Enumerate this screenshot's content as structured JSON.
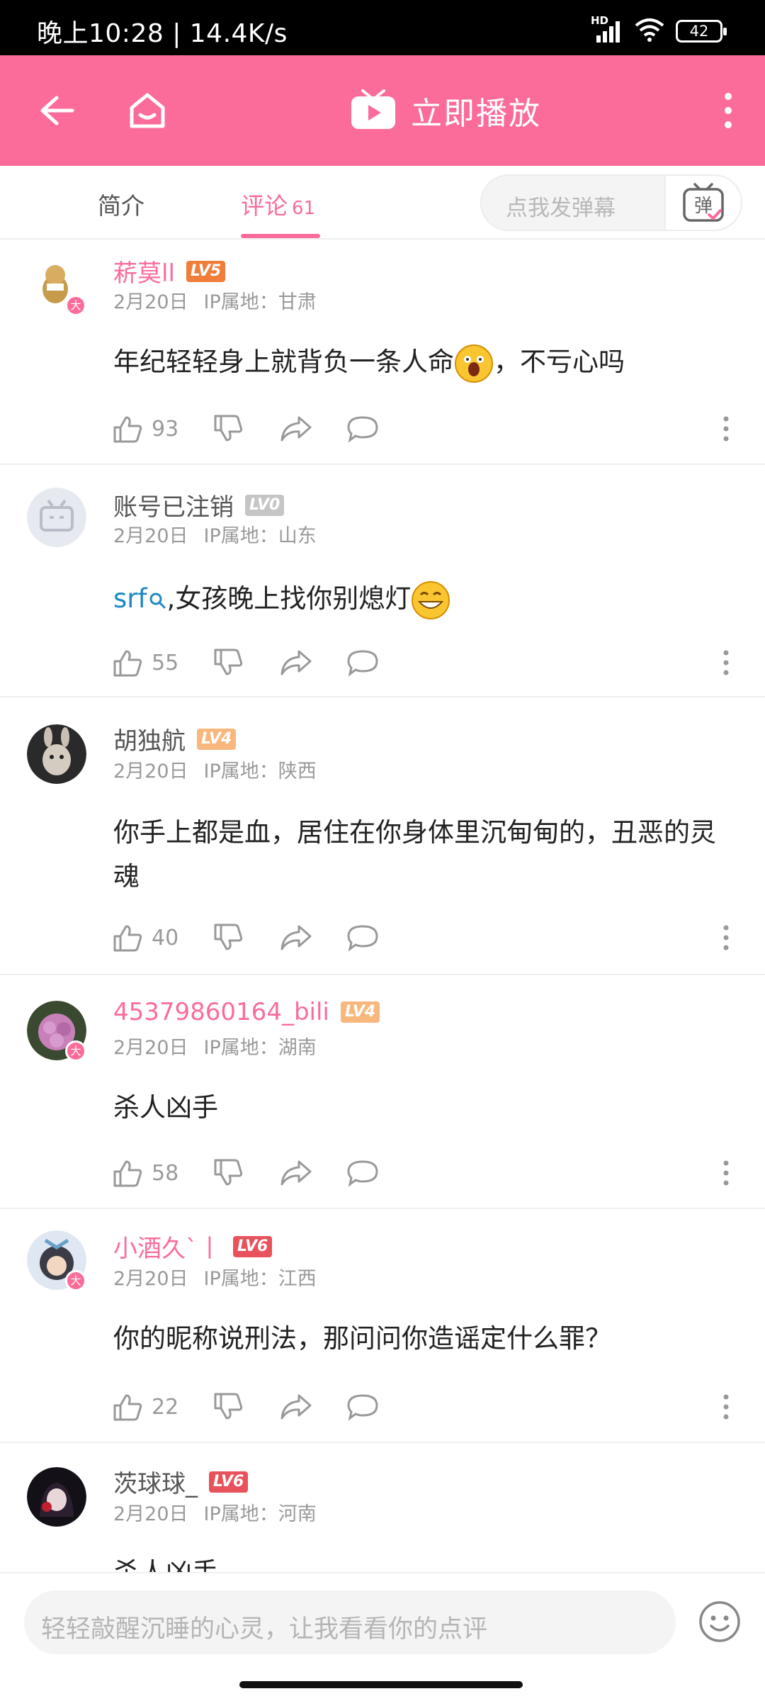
{
  "status_bar": {
    "time": "晚上10:28 | 14.4K/s",
    "hd": "HD",
    "battery": "42"
  },
  "header": {
    "play_label": "立即播放"
  },
  "tabs": [
    {
      "label": "简介"
    },
    {
      "label": "评论",
      "count": "61"
    }
  ],
  "danmaku": {
    "placeholder": "点我发弹幕",
    "button": "弹"
  },
  "comments": [
    {
      "user": "菥莫ll",
      "level": "LV5",
      "date": "2月20日",
      "ip": "IP属地：甘肃",
      "text": "年纪轻轻身上就背负一条人命",
      "text_after": "，不亏心吗",
      "likes": "93"
    },
    {
      "user": "账号已注销",
      "level": "LV0",
      "date": "2月20日",
      "ip": "IP属地：山东",
      "link": "srf",
      "text": ",女孩晚上找你别熄灯",
      "likes": "55"
    },
    {
      "user": "胡独航",
      "level": "LV4",
      "date": "2月20日",
      "ip": "IP属地：陕西",
      "text": "你手上都是血，居住在你身体里沉甸甸的，丑恶的灵魂",
      "likes": "40"
    },
    {
      "user": "45379860164_bili",
      "level": "LV4",
      "date": "2月20日",
      "ip": "IP属地：湖南",
      "text": "杀人凶手",
      "likes": "58"
    },
    {
      "user": "小酒久`丨",
      "level": "LV6",
      "date": "2月20日",
      "ip": "IP属地：江西",
      "text": "你的昵称说刑法，那问问你造谣定什么罪？",
      "likes": "22"
    },
    {
      "user": "茨球球_",
      "level": "LV6",
      "date": "2月20日",
      "ip": "IP属地：河南",
      "text": "杀人凶手"
    }
  ],
  "reply_input": {
    "placeholder": "轻轻敲醒沉睡的心灵，让我看看你的点评"
  },
  "colors": {
    "accent": "#fb6c9a",
    "lv5": "#f07d3a",
    "lv4": "#f7b77d",
    "lv6": "#e8525b",
    "lv0": "#c5c5c5",
    "link": "#1d88c2"
  }
}
